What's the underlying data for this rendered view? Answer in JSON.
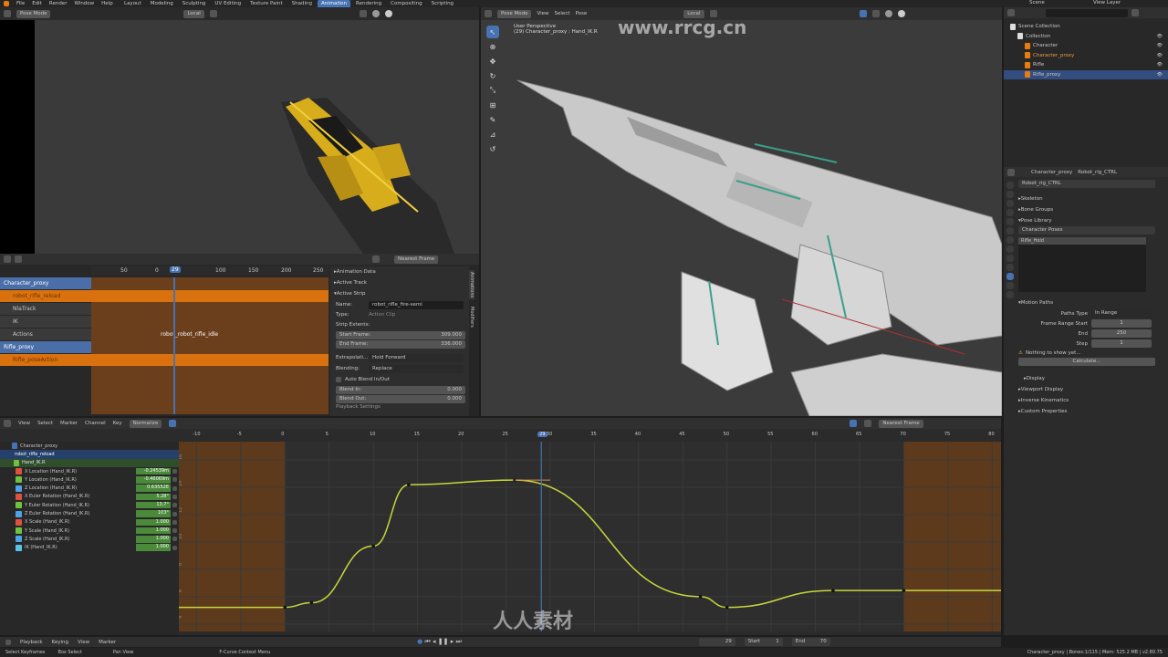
{
  "topbar": {
    "menus": [
      "File",
      "Edit",
      "Render",
      "Window",
      "Help"
    ],
    "workspaces": [
      "Layout",
      "Modeling",
      "Sculpting",
      "UV Editing",
      "Texture Paint",
      "Shading",
      "Animation",
      "Rendering",
      "Compositing",
      "Scripting"
    ],
    "active_workspace": "Animation",
    "scene": "Scene",
    "view_layer": "View Layer"
  },
  "camera_view": {
    "mode": "Pose Mode",
    "orientation": "Local"
  },
  "viewport3d": {
    "mode": "Pose Mode",
    "menus": [
      "View",
      "Select",
      "Pose"
    ],
    "orientation": "Local",
    "title": "User Perspective",
    "subtitle": "(29) Character_proxy : Hand_IK.R"
  },
  "nla": {
    "snap": "Nearest Frame",
    "ruler": [
      "50",
      "0",
      "29",
      "100",
      "150",
      "200",
      "250"
    ],
    "tracks": [
      {
        "label": "Character_proxy",
        "kind": "object"
      },
      {
        "label": "robot_rifle_reload",
        "kind": "action"
      },
      {
        "label": "NlaTrack",
        "kind": "track"
      },
      {
        "label": "IK",
        "kind": "track"
      },
      {
        "label": "Actions",
        "kind": "track"
      },
      {
        "label": "Rifle_proxy",
        "kind": "object"
      },
      {
        "label": "Rifle_poseAction",
        "kind": "action"
      }
    ],
    "strip_label": "robot_robot_rifle_idle",
    "sidebar_tabs": [
      "Animations",
      "Modifiers"
    ],
    "panels": {
      "animation_data": "Animation Data",
      "active_track": "Active Track",
      "active_strip": "Active Strip"
    },
    "strip": {
      "name_label": "Name:",
      "name": "robot_rifle_fire-semi",
      "type_label": "Type:",
      "type": "Action Clip",
      "extents_label": "Strip Extents:",
      "start_label": "Start Frame:",
      "start": "309.000",
      "end_label": "End Frame:",
      "end": "336.000",
      "extrapolation_label": "Extrapolati...",
      "extrapolation": "Hold Forward",
      "blending_label": "Blending:",
      "blending": "Replace",
      "auto_blend": "Auto Blend In/Out",
      "blend_in_label": "Blend In:",
      "blend_in": "0.000",
      "blend_out_label": "Blend Out:",
      "blend_out": "0.000",
      "playback": "Playback Settings"
    }
  },
  "graph": {
    "menus": [
      "View",
      "Select",
      "Marker",
      "Channel",
      "Key"
    ],
    "normalize": "Normalize",
    "snap": "Nearest Frame",
    "ruler": [
      "-10",
      "-5",
      "0",
      "5",
      "10",
      "15",
      "20",
      "25",
      "29",
      "30",
      "35",
      "40",
      "45",
      "50",
      "55",
      "60",
      "65",
      "70",
      "75",
      "80"
    ],
    "current_frame": 29,
    "yticks": [
      "16",
      "14",
      "12",
      "10",
      "8",
      "6",
      "4"
    ],
    "root": "Character_proxy",
    "action": "robot_rifle_reload",
    "group": "Hand_IK.R",
    "channels": [
      {
        "label": "X Location (Hand_IK.R)",
        "value": "-0.24539m",
        "color": "#e0503c"
      },
      {
        "label": "Y Location (Hand_IK.R)",
        "value": "-0.46069m",
        "color": "#6fc23f"
      },
      {
        "label": "Z Location (Hand_IK.R)",
        "value": "0.63552E",
        "color": "#4ea2e8"
      },
      {
        "label": "X Euler Rotation (Hand_IK.R)",
        "value": "5.28°",
        "color": "#e0503c"
      },
      {
        "label": "Y Euler Rotation (Hand_IK.R)",
        "value": "13.7°",
        "color": "#6fc23f"
      },
      {
        "label": "Z Euler Rotation (Hand_IK.R)",
        "value": "103°",
        "color": "#4ea2e8"
      },
      {
        "label": "X Scale (Hand_IK.R)",
        "value": "1.000",
        "color": "#e0503c"
      },
      {
        "label": "Y Scale (Hand_IK.R)",
        "value": "1.000",
        "color": "#6fc23f"
      },
      {
        "label": "Z Scale (Hand_IK.R)",
        "value": "1.000",
        "color": "#4ea2e8"
      },
      {
        "label": "IK (Hand_IK.R)",
        "value": "1.000",
        "color": "#58c2e8"
      }
    ]
  },
  "timeline": {
    "menus": [
      "Playback",
      "Keying",
      "View",
      "Marker"
    ],
    "frame": "29",
    "start_label": "Start",
    "start": "1",
    "end_label": "End",
    "end": "70"
  },
  "status": {
    "left": [
      "Select Keyframes",
      "Box Select",
      "Pan View",
      "F-Curve Context Menu"
    ],
    "right": "Character_proxy | Bones:1/115 | Mem: 525.2 MB | v2.80.75"
  },
  "outliner": {
    "root": "Scene Collection",
    "items": [
      {
        "label": "Collection",
        "indent": 1
      },
      {
        "label": "Character",
        "indent": 2
      },
      {
        "label": "Character_proxy",
        "indent": 2
      },
      {
        "label": "Rifle",
        "indent": 2
      },
      {
        "label": "Rifle_proxy",
        "indent": 2
      }
    ]
  },
  "props": {
    "object": "Character_proxy",
    "armature": "Robot_rig_CTRL",
    "data_field": "Robot_rig_CTRL",
    "sections": [
      "Skeleton",
      "Bone Groups",
      "Pose Library"
    ],
    "pose_lib_name": "Character Poses",
    "pose_item": "Rifle_Hold",
    "motion_paths": "Motion Paths",
    "paths_type_label": "Paths Type",
    "paths_type": "In Range",
    "range_start_label": "Frame Range Start",
    "range_start": "1",
    "range_end_label": "End",
    "range_end": "250",
    "step_label": "Step",
    "step": "1",
    "nothing": "Nothing to show yet...",
    "calculate": "Calculate...",
    "more": [
      "Display",
      "Viewport Display",
      "Inverse Kinematics",
      "Custom Properties"
    ]
  },
  "watermarks": {
    "top": "www.rrcg.cn",
    "bottom": "人人素材"
  }
}
